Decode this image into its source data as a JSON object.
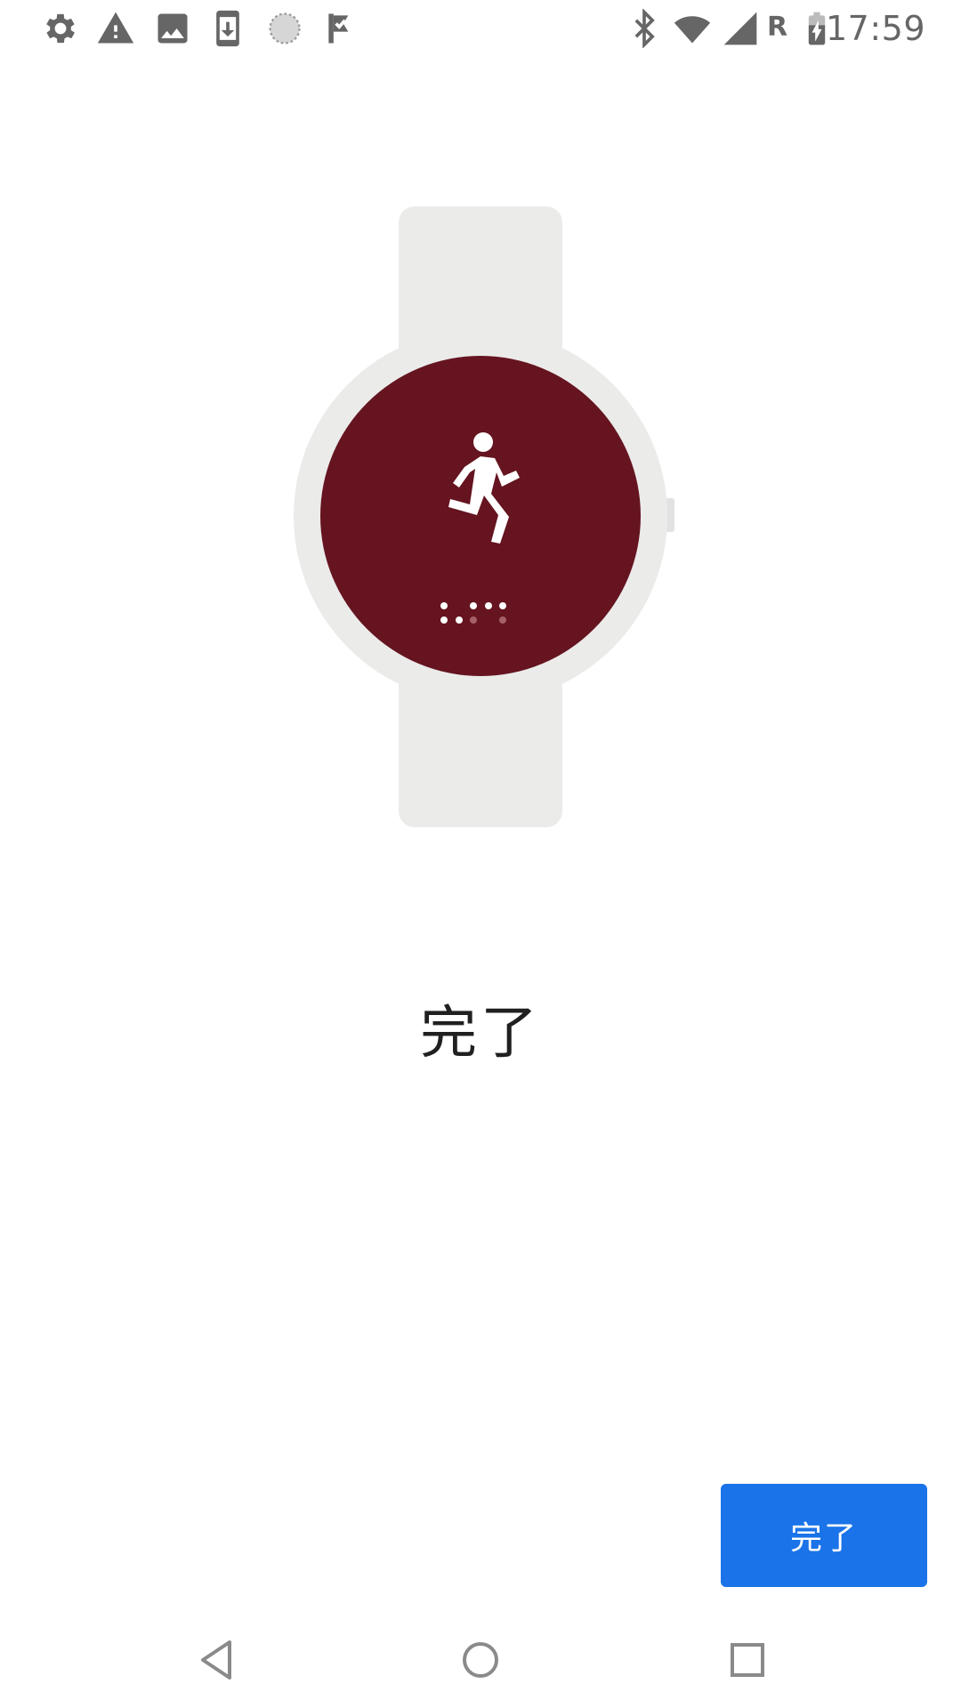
{
  "status_bar": {
    "time": "17:59",
    "roaming_indicator": "R",
    "left_icons": [
      "settings-icon",
      "warning-icon",
      "image-icon",
      "download-phone-icon",
      "sync-circle-icon",
      "check-flag-icon"
    ],
    "right_icons": [
      "bluetooth-icon",
      "wifi-icon",
      "cell-signal-icon",
      "battery-charging-icon"
    ]
  },
  "illustration": {
    "watch_face_color": "#651420",
    "watch_body_color": "#ebebea",
    "strap_color": "#ebebea",
    "activity_icon": "running-person-icon",
    "page_dots": 7
  },
  "main": {
    "title": "完了"
  },
  "footer": {
    "done_label": "完了",
    "accent_color": "#1a73e8"
  },
  "nav_bar": {
    "buttons": [
      "back-icon",
      "home-icon",
      "recents-icon"
    ]
  }
}
